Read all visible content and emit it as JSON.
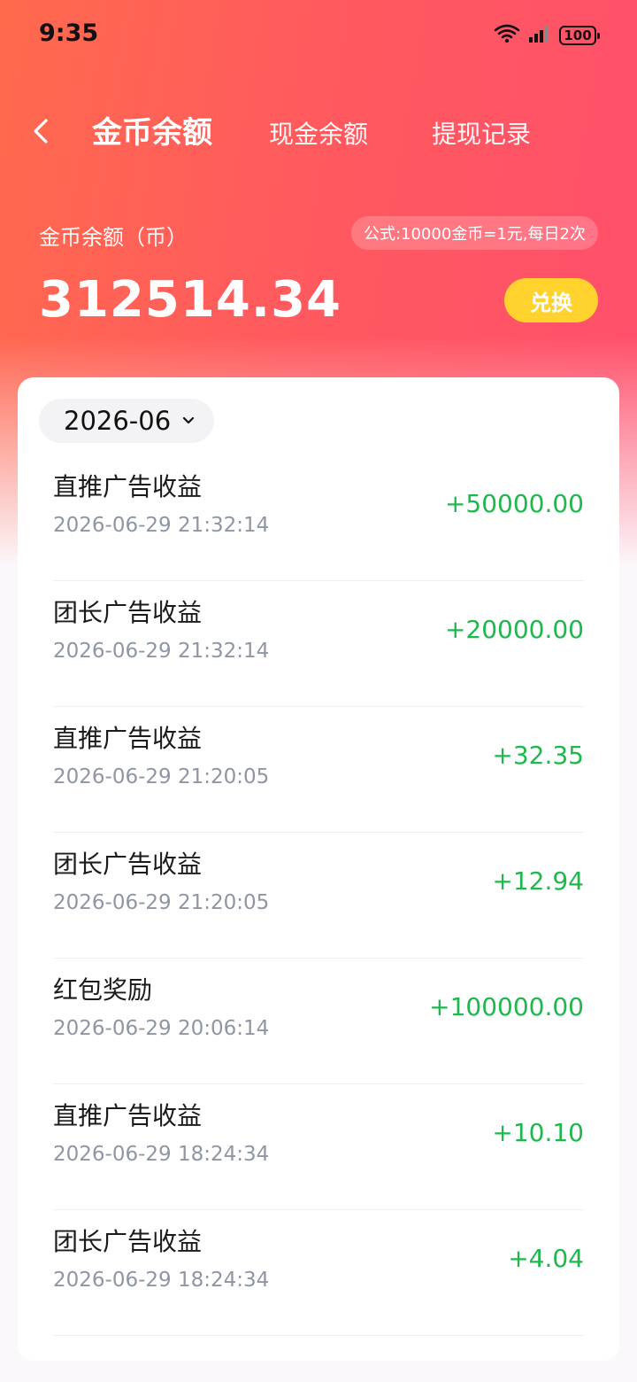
{
  "status_bar": {
    "time": "9:35",
    "battery": "100",
    "icons": [
      "wifi-icon",
      "signal-icon",
      "battery-icon"
    ]
  },
  "nav": {
    "tabs": [
      {
        "label": "金币余额",
        "active": true
      },
      {
        "label": "现金余额",
        "active": false
      },
      {
        "label": "提现记录",
        "active": false
      }
    ]
  },
  "balance": {
    "label": "金币余额（币）",
    "formula": "公式:10000金币=1元,每日2次",
    "value": "312514.34",
    "exchange_label": "兑换"
  },
  "filter": {
    "month": "2026-06"
  },
  "records": [
    {
      "title": "直推广告收益",
      "time": "2026-06-29 21:32:14",
      "amount": "+50000.00"
    },
    {
      "title": "团长广告收益",
      "time": "2026-06-29 21:32:14",
      "amount": "+20000.00"
    },
    {
      "title": "直推广告收益",
      "time": "2026-06-29 21:20:05",
      "amount": "+32.35"
    },
    {
      "title": "团长广告收益",
      "time": "2026-06-29 21:20:05",
      "amount": "+12.94"
    },
    {
      "title": "红包奖励",
      "time": "2026-06-29 20:06:14",
      "amount": "+100000.00"
    },
    {
      "title": "直推广告收益",
      "time": "2026-06-29 18:24:34",
      "amount": "+10.10"
    },
    {
      "title": "团长广告收益",
      "time": "2026-06-29 18:24:34",
      "amount": "+4.04"
    }
  ],
  "colors": {
    "header_start": "#ff6a4d",
    "header_end": "#ff4f6c",
    "exchange_button": "#ffd22e",
    "amount_positive": "#1fb84e"
  }
}
